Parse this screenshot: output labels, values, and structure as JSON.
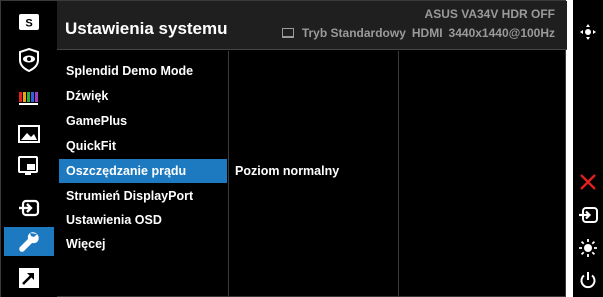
{
  "header": {
    "title": "Ustawienia systemu",
    "model": "ASUS  VA34V HDR OFF",
    "mode": "Tryb Standardowy",
    "input": "HDMI",
    "resolution": "3440x1440@100Hz"
  },
  "nav_icons": [
    {
      "name": "splendid-icon"
    },
    {
      "name": "eye-care-icon"
    },
    {
      "name": "color-icon"
    },
    {
      "name": "image-icon"
    },
    {
      "name": "pip-icon"
    },
    {
      "name": "input-select-icon"
    },
    {
      "name": "system-setup-icon",
      "active": true
    },
    {
      "name": "shortcut-icon"
    }
  ],
  "menu": {
    "items": [
      {
        "label": "Splendid Demo Mode"
      },
      {
        "label": "Dźwięk"
      },
      {
        "label": "GamePlus"
      },
      {
        "label": "QuickFit"
      },
      {
        "label": "Oszczędzanie prądu",
        "selected": true
      },
      {
        "label": "Strumień DisplayPort"
      },
      {
        "label": "Ustawienia OSD"
      },
      {
        "label": "Więcej"
      }
    ]
  },
  "submenu": {
    "selected_value": "Poziom normalny"
  },
  "controls": [
    {
      "name": "navigate-joystick-icon"
    },
    {
      "name": "close-icon"
    },
    {
      "name": "input-icon"
    },
    {
      "name": "brightness-icon"
    },
    {
      "name": "power-icon"
    }
  ],
  "colors": {
    "accent": "#1d79c0",
    "close": "#e02020",
    "header_bg": "#1f1f1f",
    "dim_text": "#9a9a9a"
  }
}
